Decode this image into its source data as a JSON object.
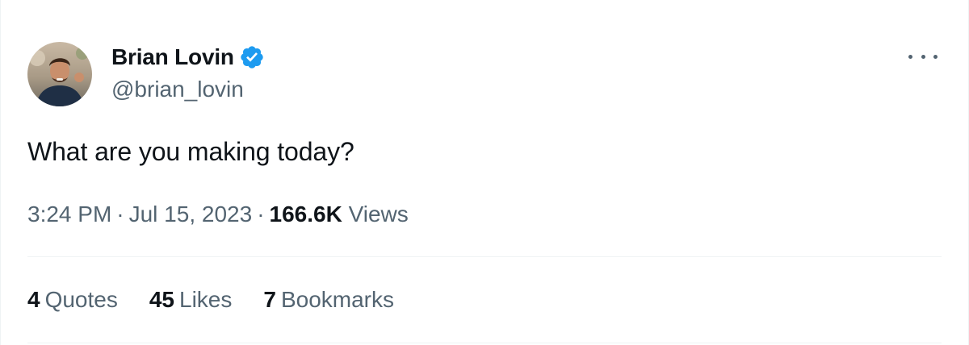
{
  "author": {
    "display_name": "Brian Lovin",
    "handle": "@brian_lovin",
    "verified": true,
    "verified_color": "#1d9bf0"
  },
  "tweet": {
    "text": "What are you making today?",
    "time": "3:24 PM",
    "date": "Jul 15, 2023",
    "separator": "·",
    "views_count": "166.6K",
    "views_label": "Views"
  },
  "stats": [
    {
      "count": "4",
      "label": "Quotes"
    },
    {
      "count": "45",
      "label": "Likes"
    },
    {
      "count": "7",
      "label": "Bookmarks"
    }
  ],
  "icons": {
    "more": "more-horizontal-icon",
    "verified": "verified-badge-icon"
  },
  "colors": {
    "text_primary": "#0f1419",
    "text_secondary": "#536471",
    "divider": "#eff3f4"
  }
}
